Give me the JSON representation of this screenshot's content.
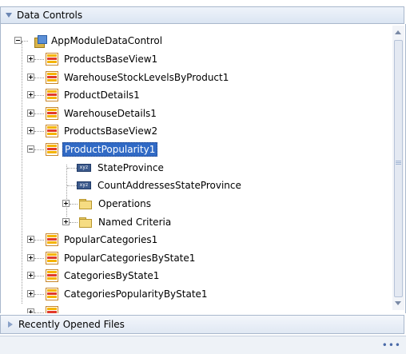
{
  "panels": {
    "data_controls": "Data Controls",
    "recently_opened": "Recently Opened Files"
  },
  "tree": {
    "root": "AppModuleDataControl",
    "items": [
      "ProductsBaseView1",
      "WarehouseStockLevelsByProduct1",
      "ProductDetails1",
      "WarehouseDetails1",
      "ProductsBaseView2",
      "ProductPopularity1",
      "PopularCategories1",
      "PopularCategoriesByState1",
      "CategoriesByState1",
      "CategoriesPopularityByState1"
    ],
    "children": {
      "attributes": [
        "StateProvince",
        "CountAddressesStateProvince"
      ],
      "attribute_icon_text": "xyz",
      "folders": [
        "Operations",
        "Named Criteria"
      ]
    },
    "selected": "ProductPopularity1"
  },
  "statusbar": {
    "dots": "•••"
  },
  "colors": {
    "selection": "#316ac5",
    "header": "#dbe5f2",
    "view_icon_stripes": [
      "#f5b400",
      "#e23a2a",
      "#f5b400"
    ]
  }
}
